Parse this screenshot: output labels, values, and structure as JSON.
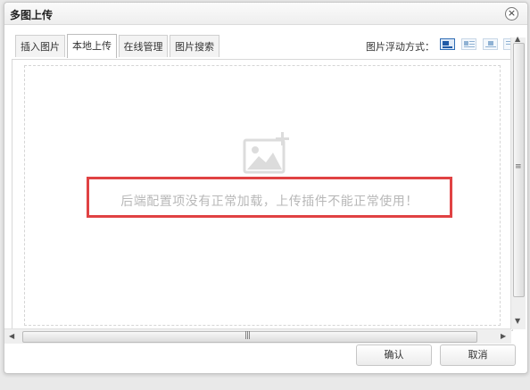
{
  "dialog": {
    "title": "多图上传",
    "close_glyph": "×"
  },
  "tabs": [
    {
      "label": "插入图片",
      "active": false
    },
    {
      "label": "本地上传",
      "active": true
    },
    {
      "label": "在线管理",
      "active": false
    },
    {
      "label": "图片搜索",
      "active": false
    }
  ],
  "float_mode": {
    "label": "图片浮动方式：",
    "options": [
      "float-none-icon",
      "float-left-icon",
      "float-center-icon",
      "float-right-icon"
    ],
    "selected": "float-none-icon"
  },
  "upload": {
    "icon": "image-add-icon",
    "error_message": "后端配置项没有正常加载，上传插件不能正常使用！"
  },
  "buttons": {
    "confirm": "确认",
    "cancel": "取消"
  },
  "colors": {
    "error_border": "#e04243",
    "error_text": "#b8b8b8",
    "selected_icon": "#1f5aa6"
  }
}
